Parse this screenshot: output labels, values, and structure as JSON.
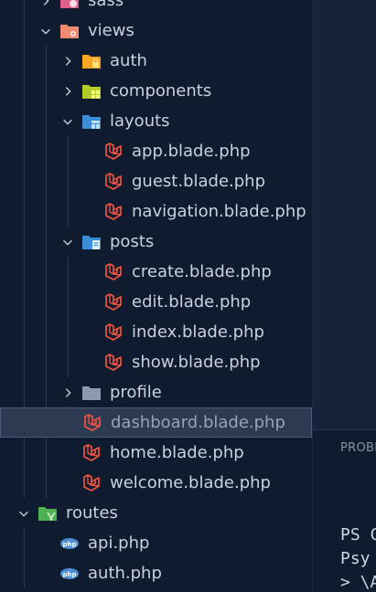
{
  "tree": [
    {
      "label": "sass",
      "depth": 2,
      "kind": "folder",
      "expanded": false,
      "icon": "sass-folder-icon",
      "color": "#e05d8a"
    },
    {
      "label": "views",
      "depth": 2,
      "kind": "folder",
      "expanded": true,
      "icon": "views-folder-icon",
      "color": "#f08a70"
    },
    {
      "label": "auth",
      "depth": 3,
      "kind": "folder",
      "expanded": false,
      "icon": "auth-folder-icon",
      "color": "#f5a623"
    },
    {
      "label": "components",
      "depth": 3,
      "kind": "folder",
      "expanded": false,
      "icon": "components-folder-icon",
      "color": "#b5cc2a"
    },
    {
      "label": "layouts",
      "depth": 3,
      "kind": "folder",
      "expanded": true,
      "icon": "layouts-folder-icon",
      "color": "#3b8ed8"
    },
    {
      "label": "app.blade.php",
      "depth": 4,
      "kind": "file",
      "icon": "laravel-icon",
      "color": "#f05340"
    },
    {
      "label": "guest.blade.php",
      "depth": 4,
      "kind": "file",
      "icon": "laravel-icon",
      "color": "#f05340"
    },
    {
      "label": "navigation.blade.php",
      "depth": 4,
      "kind": "file",
      "icon": "laravel-icon",
      "color": "#f05340"
    },
    {
      "label": "posts",
      "depth": 3,
      "kind": "folder",
      "expanded": true,
      "icon": "posts-folder-icon",
      "color": "#3b8ed8"
    },
    {
      "label": "create.blade.php",
      "depth": 4,
      "kind": "file",
      "icon": "laravel-icon",
      "color": "#f05340"
    },
    {
      "label": "edit.blade.php",
      "depth": 4,
      "kind": "file",
      "icon": "laravel-icon",
      "color": "#f05340"
    },
    {
      "label": "index.blade.php",
      "depth": 4,
      "kind": "file",
      "icon": "laravel-icon",
      "color": "#f05340"
    },
    {
      "label": "show.blade.php",
      "depth": 4,
      "kind": "file",
      "icon": "laravel-icon",
      "color": "#f05340"
    },
    {
      "label": "profile",
      "depth": 3,
      "kind": "folder",
      "expanded": false,
      "icon": "folder-icon",
      "color": "#8b9ab0"
    },
    {
      "label": "dashboard.blade.php",
      "depth": 3,
      "kind": "file",
      "icon": "laravel-icon",
      "color": "#f05340",
      "selected": true
    },
    {
      "label": "home.blade.php",
      "depth": 3,
      "kind": "file",
      "icon": "laravel-icon",
      "color": "#f05340"
    },
    {
      "label": "welcome.blade.php",
      "depth": 3,
      "kind": "file",
      "icon": "laravel-icon",
      "color": "#f05340"
    },
    {
      "label": "routes",
      "depth": 1,
      "kind": "folder",
      "expanded": true,
      "icon": "routes-folder-icon",
      "color": "#4caf50"
    },
    {
      "label": "api.php",
      "depth": 2,
      "kind": "file",
      "icon": "php-icon",
      "color": "#4f8fd6"
    },
    {
      "label": "auth.php",
      "depth": 2,
      "kind": "file",
      "icon": "php-icon",
      "color": "#4f8fd6"
    }
  ],
  "panel": {
    "tab_label": "PROBLEMS",
    "terminal_lines": [
      "PS C",
      "Psy",
      "> \\A"
    ]
  },
  "colors": {
    "sidebar_bg": "#0f1b2e",
    "editor_bg": "#17233a",
    "selection_bg": "#2c3a52",
    "text": "#c9d1e0"
  }
}
